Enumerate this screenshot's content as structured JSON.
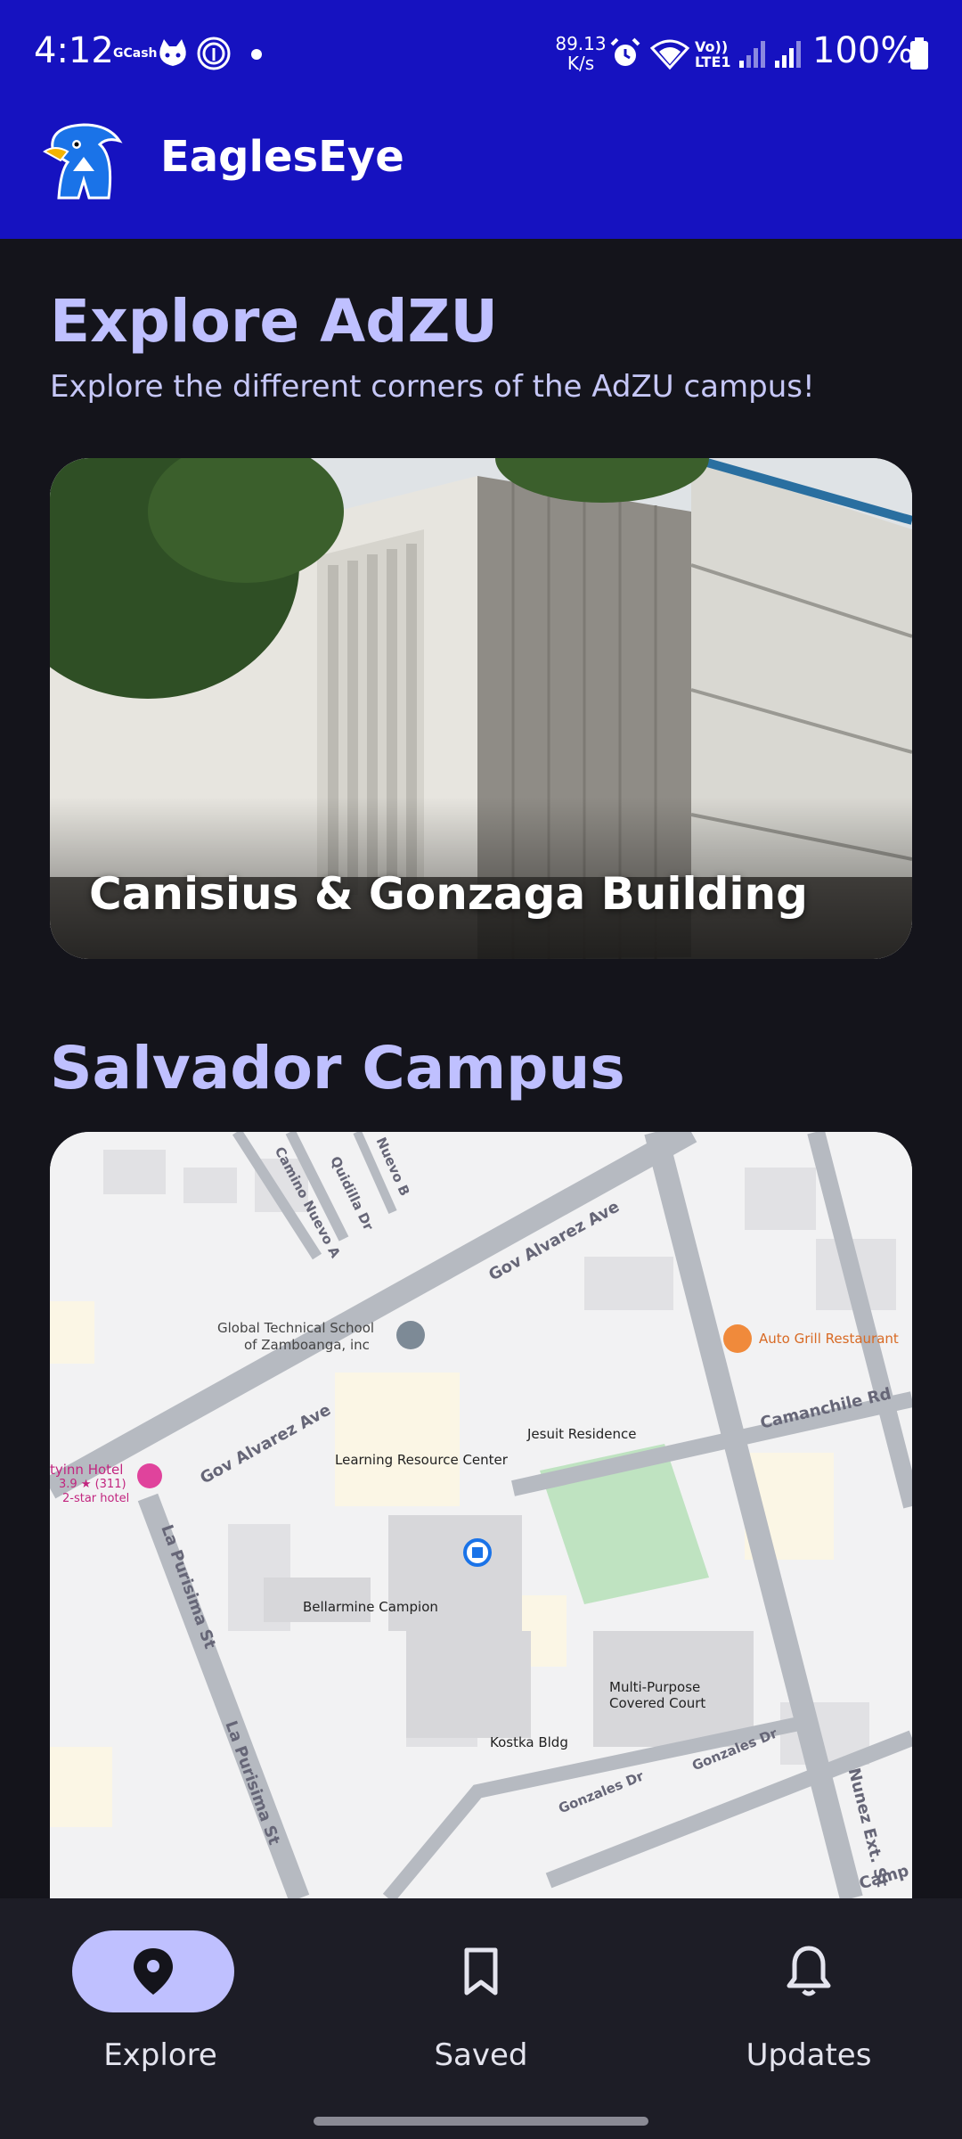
{
  "status_bar": {
    "time": "4:12",
    "gcash": "GCash",
    "speed_value": "89.13",
    "speed_unit": "K/s",
    "lte_top": "Vo))",
    "lte_bottom": "LTE1",
    "battery": "100%"
  },
  "app": {
    "title": "EaglesEye"
  },
  "explore": {
    "title": "Explore AdZU",
    "subtitle": "Explore the different corners of the AdZU campus!",
    "card_label": "Canisius & Gonzaga Building"
  },
  "campus": {
    "title": "Salvador Campus",
    "map_labels": {
      "school": "Global Technical School",
      "school2": "of Zamboanga, inc",
      "restaurant": "Auto Grill Restaurant",
      "jesuit": "Jesuit Residence",
      "lrc": "Learning Resource Center",
      "hotel": "tyinn Hotel",
      "hotel_rating": "3.9 ★ (311)",
      "hotel_class": "2-star hotel",
      "bellarmine": "Bellarmine Campion",
      "covered_court": "Multi-Purpose",
      "covered_court2": "Covered Court",
      "kostka": "Kostka Bldg",
      "road_gov1": "Gov Alvarez Ave",
      "road_gov2": "Gov Alvarez Ave",
      "road_camino": "Camino Nuevo A",
      "road_quidilla": "Quidilla Dr",
      "road_nuevo": "Nuevo B",
      "road_lapurisima1": "La Purisima St",
      "road_lapurisima2": "La Purisima St",
      "road_camanchile": "Camanchile Rd",
      "road_gonzales1": "Gonzales Dr",
      "road_gonzales2": "Gonzales Dr",
      "road_nunez": "Nunez Ext. St",
      "road_camp": "Camp"
    }
  },
  "nav": {
    "explore": "Explore",
    "saved": "Saved",
    "updates": "Updates"
  },
  "colors": {
    "appbar": "#1612c0",
    "accent": "#bfc0ff",
    "background": "#14141b",
    "nav_background": "#1d1d26"
  }
}
